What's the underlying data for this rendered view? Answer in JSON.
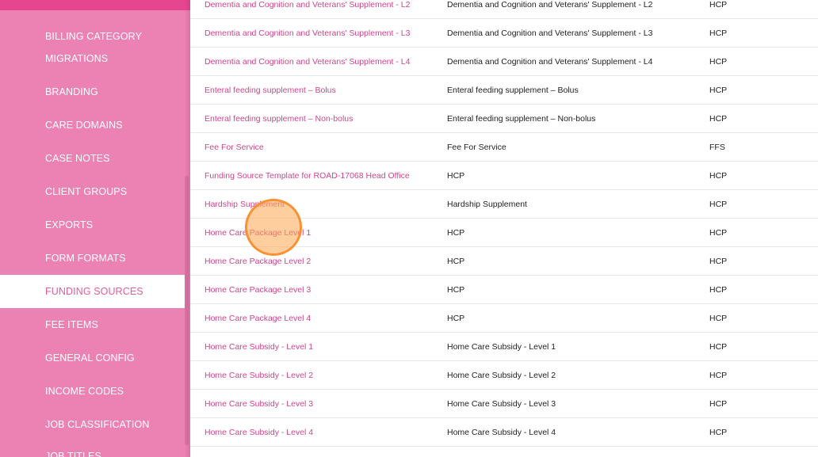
{
  "sidebar": {
    "items": [
      {
        "label": "BILLING CATEGORY",
        "active": false
      },
      {
        "label": "MIGRATIONS",
        "active": false
      },
      {
        "label": "BRANDING",
        "active": false
      },
      {
        "label": "CARE DOMAINS",
        "active": false
      },
      {
        "label": "CASE NOTES",
        "active": false
      },
      {
        "label": "CLIENT GROUPS",
        "active": false
      },
      {
        "label": "EXPORTS",
        "active": false
      },
      {
        "label": "FORM FORMATS",
        "active": false
      },
      {
        "label": "FUNDING SOURCES",
        "active": true
      },
      {
        "label": "FEE ITEMS",
        "active": false
      },
      {
        "label": "GENERAL CONFIG",
        "active": false
      },
      {
        "label": "INCOME CODES",
        "active": false
      },
      {
        "label": "JOB CLASSIFICATION",
        "active": false
      },
      {
        "label": "JOB TITLES",
        "active": false
      }
    ],
    "colors": {
      "background": "#ec82b4",
      "active_background": "#ffffff",
      "active_text": "#e25d9b",
      "top_bar": "#e6468f"
    }
  },
  "table": {
    "rows": [
      {
        "name": "Dementia and Cognition and Veterans' Supplement - L2",
        "description": "Dementia and Cognition and Veterans' Supplement - L2",
        "type": "HCP"
      },
      {
        "name": "Dementia and Cognition and Veterans' Supplement - L3",
        "description": "Dementia and Cognition and Veterans' Supplement - L3",
        "type": "HCP"
      },
      {
        "name": "Dementia and Cognition and Veterans' Supplement - L4",
        "description": "Dementia and Cognition and Veterans' Supplement - L4",
        "type": "HCP"
      },
      {
        "name": "Enteral feeding supplement – Bolus",
        "description": "Enteral feeding supplement – Bolus",
        "type": "HCP"
      },
      {
        "name": "Enteral feeding supplement – Non-bolus",
        "description": "Enteral feeding supplement – Non-bolus",
        "type": "HCP"
      },
      {
        "name": "Fee For Service",
        "description": "Fee For Service",
        "type": "FFS"
      },
      {
        "name": "Funding Source Template for ROAD-17068 Head Office",
        "description": "HCP",
        "type": "HCP"
      },
      {
        "name": "Hardship Supplement",
        "description": "Hardship Supplement",
        "type": "HCP"
      },
      {
        "name": "Home Care Package Level 1",
        "description": "HCP",
        "type": "HCP"
      },
      {
        "name": "Home Care Package Level 2",
        "description": "HCP",
        "type": "HCP"
      },
      {
        "name": "Home Care Package Level 3",
        "description": "HCP",
        "type": "HCP"
      },
      {
        "name": "Home Care Package Level 4",
        "description": "HCP",
        "type": "HCP"
      },
      {
        "name": "Home Care Subsidy - Level 1",
        "description": "Home Care Subsidy - Level 1",
        "type": "HCP"
      },
      {
        "name": "Home Care Subsidy - Level 2",
        "description": "Home Care Subsidy - Level 2",
        "type": "HCP"
      },
      {
        "name": "Home Care Subsidy - Level 3",
        "description": "Home Care Subsidy - Level 3",
        "type": "HCP"
      },
      {
        "name": "Home Care Subsidy - Level 4",
        "description": "Home Care Subsidy - Level 4",
        "type": "HCP"
      }
    ],
    "colors": {
      "link": "#d0458a",
      "text": "#222222",
      "divider": "#e8e8e8"
    }
  },
  "click_marker": {
    "color": "#f78c28"
  }
}
